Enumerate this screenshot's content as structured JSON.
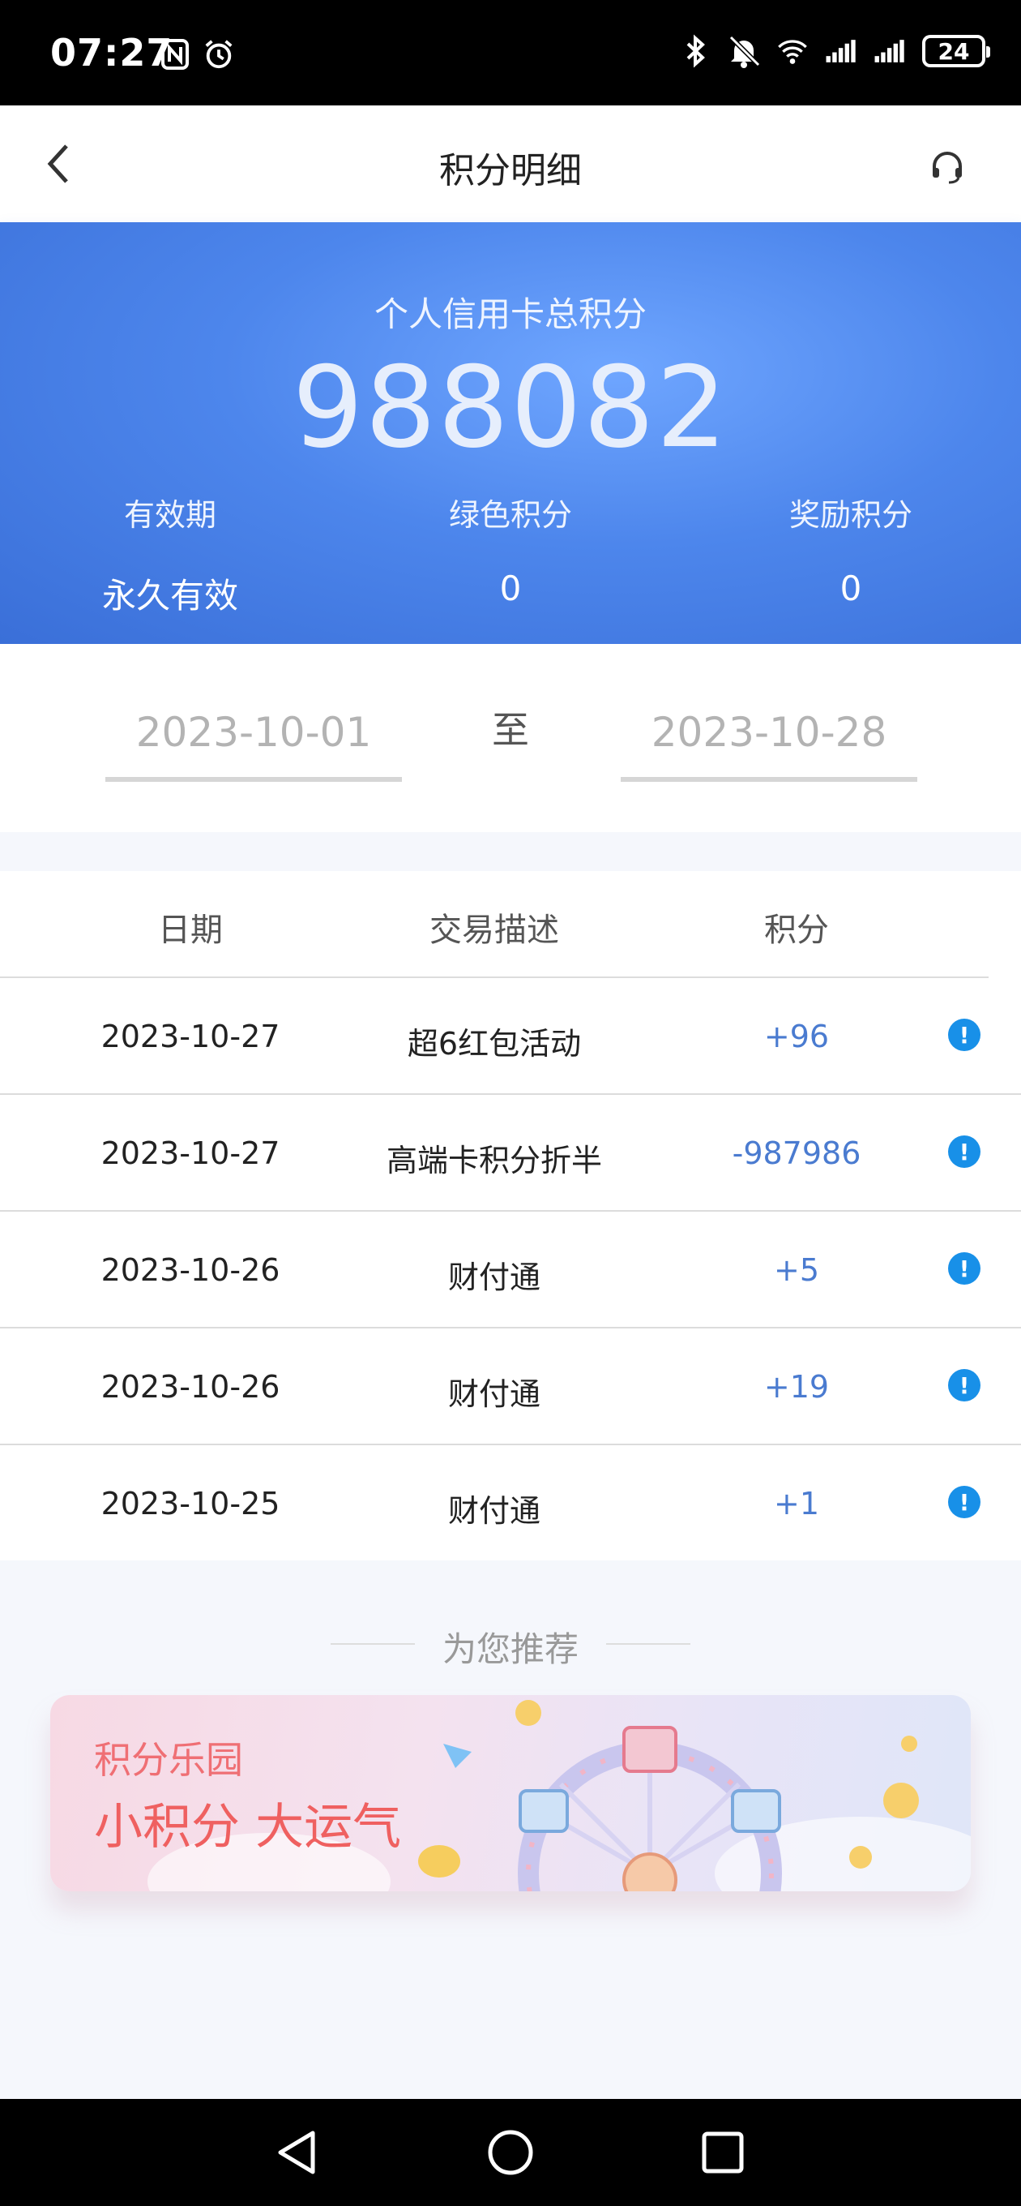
{
  "status_bar": {
    "time": "07:27",
    "icons": [
      "nfc-icon",
      "alarm-icon",
      "bluetooth-icon",
      "mute-icon",
      "wifi-icon",
      "signal-icon",
      "signal-icon"
    ],
    "battery": "24"
  },
  "header": {
    "title": "积分明细",
    "back_icon": "chevron-left-icon",
    "support_icon": "headset-icon"
  },
  "summary": {
    "label": "个人信用卡总积分",
    "total": "988082",
    "columns": [
      {
        "key": "有效期",
        "value": "永久有效"
      },
      {
        "key": "绿色积分",
        "value": "0"
      },
      {
        "key": "奖励积分",
        "value": "0"
      }
    ]
  },
  "date_range": {
    "start": "2023-10-01",
    "separator": "至",
    "end": "2023-10-28"
  },
  "table": {
    "headers": [
      "日期",
      "交易描述",
      "积分"
    ],
    "rows": [
      {
        "date": "2023-10-27",
        "desc": "超6红包活动",
        "points": "+96"
      },
      {
        "date": "2023-10-27",
        "desc": "高端卡积分折半",
        "points": "-987986"
      },
      {
        "date": "2023-10-26",
        "desc": "财付通",
        "points": "+5"
      },
      {
        "date": "2023-10-26",
        "desc": "财付通",
        "points": "+19"
      },
      {
        "date": "2023-10-25",
        "desc": "财付通",
        "points": "+1"
      }
    ]
  },
  "recommend": {
    "title": "为您推荐",
    "banner_line1": "积分乐园",
    "banner_line2": "小积分 大运气"
  },
  "colors": {
    "hero_blue": "#4d86ec",
    "points_blue": "#4a7bd0",
    "info_blue": "#1890e8",
    "banner_red": "#ef6060"
  }
}
